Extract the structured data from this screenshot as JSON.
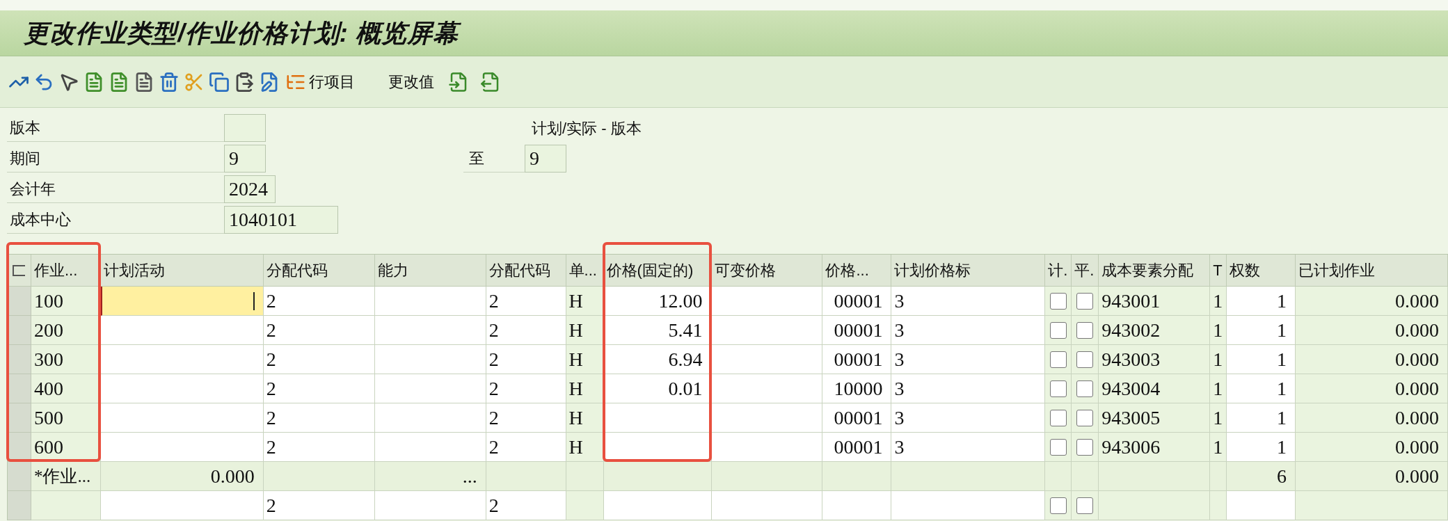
{
  "window": {
    "title": "更改作业类型/作业价格计划: 概览屏幕"
  },
  "toolbar": {
    "line_items_label": "行项目",
    "change_values_label": "更改值"
  },
  "form": {
    "fields": [
      {
        "label": "版本"
      },
      {
        "label": "期间",
        "value": "9"
      },
      {
        "label": "会计年",
        "value": "2024"
      },
      {
        "label": "成本中心",
        "value": "1040101"
      }
    ],
    "version_text": "计划/实际 - 版本",
    "to_label": "至",
    "to_value": "9"
  },
  "table": {
    "columns": [
      {
        "label": "作业...",
        "kind": "key",
        "highlighted": true
      },
      {
        "label": "计划活动",
        "kind": "edit",
        "highlighted": false
      },
      {
        "label": "分配代码",
        "kind": "edit",
        "highlighted": false
      },
      {
        "label": "能力",
        "kind": "edit",
        "highlighted": false
      },
      {
        "label": "分配代码",
        "kind": "edit",
        "highlighted": false
      },
      {
        "label": "单...",
        "kind": "key",
        "highlighted": false
      },
      {
        "label": "价格(固定的)",
        "kind": "edit",
        "highlighted": true
      },
      {
        "label": "可变价格",
        "kind": "edit",
        "highlighted": false
      },
      {
        "label": "价格...",
        "kind": "edit",
        "highlighted": false
      },
      {
        "label": "计划价格标",
        "kind": "edit",
        "highlighted": false
      },
      {
        "label": "计.",
        "kind": "check",
        "highlighted": false
      },
      {
        "label": "平.",
        "kind": "check",
        "highlighted": false
      },
      {
        "label": "成本要素分配",
        "kind": "key",
        "highlighted": false
      },
      {
        "label": "T",
        "kind": "key",
        "highlighted": false
      },
      {
        "label": "权数",
        "kind": "edit",
        "highlighted": false
      },
      {
        "label": "已计划作业",
        "kind": "key",
        "highlighted": false
      }
    ],
    "rows": [
      {
        "kind": "data",
        "editing": true,
        "cells": [
          "100",
          null,
          "2",
          null,
          "2",
          "H",
          "12.00",
          null,
          "00001",
          "3",
          false,
          false,
          "943001",
          "1",
          "1",
          "0.000"
        ]
      },
      {
        "kind": "data",
        "editing": false,
        "cells": [
          "200",
          null,
          "2",
          null,
          "2",
          "H",
          "5.41",
          null,
          "00001",
          "3",
          false,
          false,
          "943002",
          "1",
          "1",
          "0.000"
        ]
      },
      {
        "kind": "data",
        "editing": false,
        "cells": [
          "300",
          null,
          "2",
          null,
          "2",
          "H",
          "6.94",
          null,
          "00001",
          "3",
          false,
          false,
          "943003",
          "1",
          "1",
          "0.000"
        ]
      },
      {
        "kind": "data",
        "editing": false,
        "cells": [
          "400",
          null,
          "2",
          null,
          "2",
          "H",
          "0.01",
          null,
          "10000",
          "3",
          false,
          false,
          "943004",
          "1",
          "1",
          "0.000"
        ]
      },
      {
        "kind": "data",
        "editing": false,
        "cells": [
          "500",
          null,
          "2",
          null,
          "2",
          "H",
          null,
          null,
          "00001",
          "3",
          false,
          false,
          "943005",
          "1",
          "1",
          "0.000"
        ]
      },
      {
        "kind": "data",
        "editing": false,
        "cells": [
          "600",
          null,
          "2",
          null,
          "2",
          "H",
          null,
          null,
          "00001",
          "3",
          false,
          false,
          "943006",
          "1",
          "1",
          "0.000"
        ]
      },
      {
        "kind": "total",
        "editing": false,
        "cells": [
          "*作业...",
          "0.000",
          null,
          "...",
          null,
          null,
          null,
          null,
          null,
          null,
          null,
          null,
          null,
          null,
          "6",
          "0.000"
        ]
      },
      {
        "kind": "data",
        "editing": false,
        "cells": [
          null,
          null,
          "2",
          null,
          "2",
          null,
          null,
          null,
          null,
          null,
          false,
          false,
          null,
          null,
          null,
          null
        ]
      }
    ]
  }
}
